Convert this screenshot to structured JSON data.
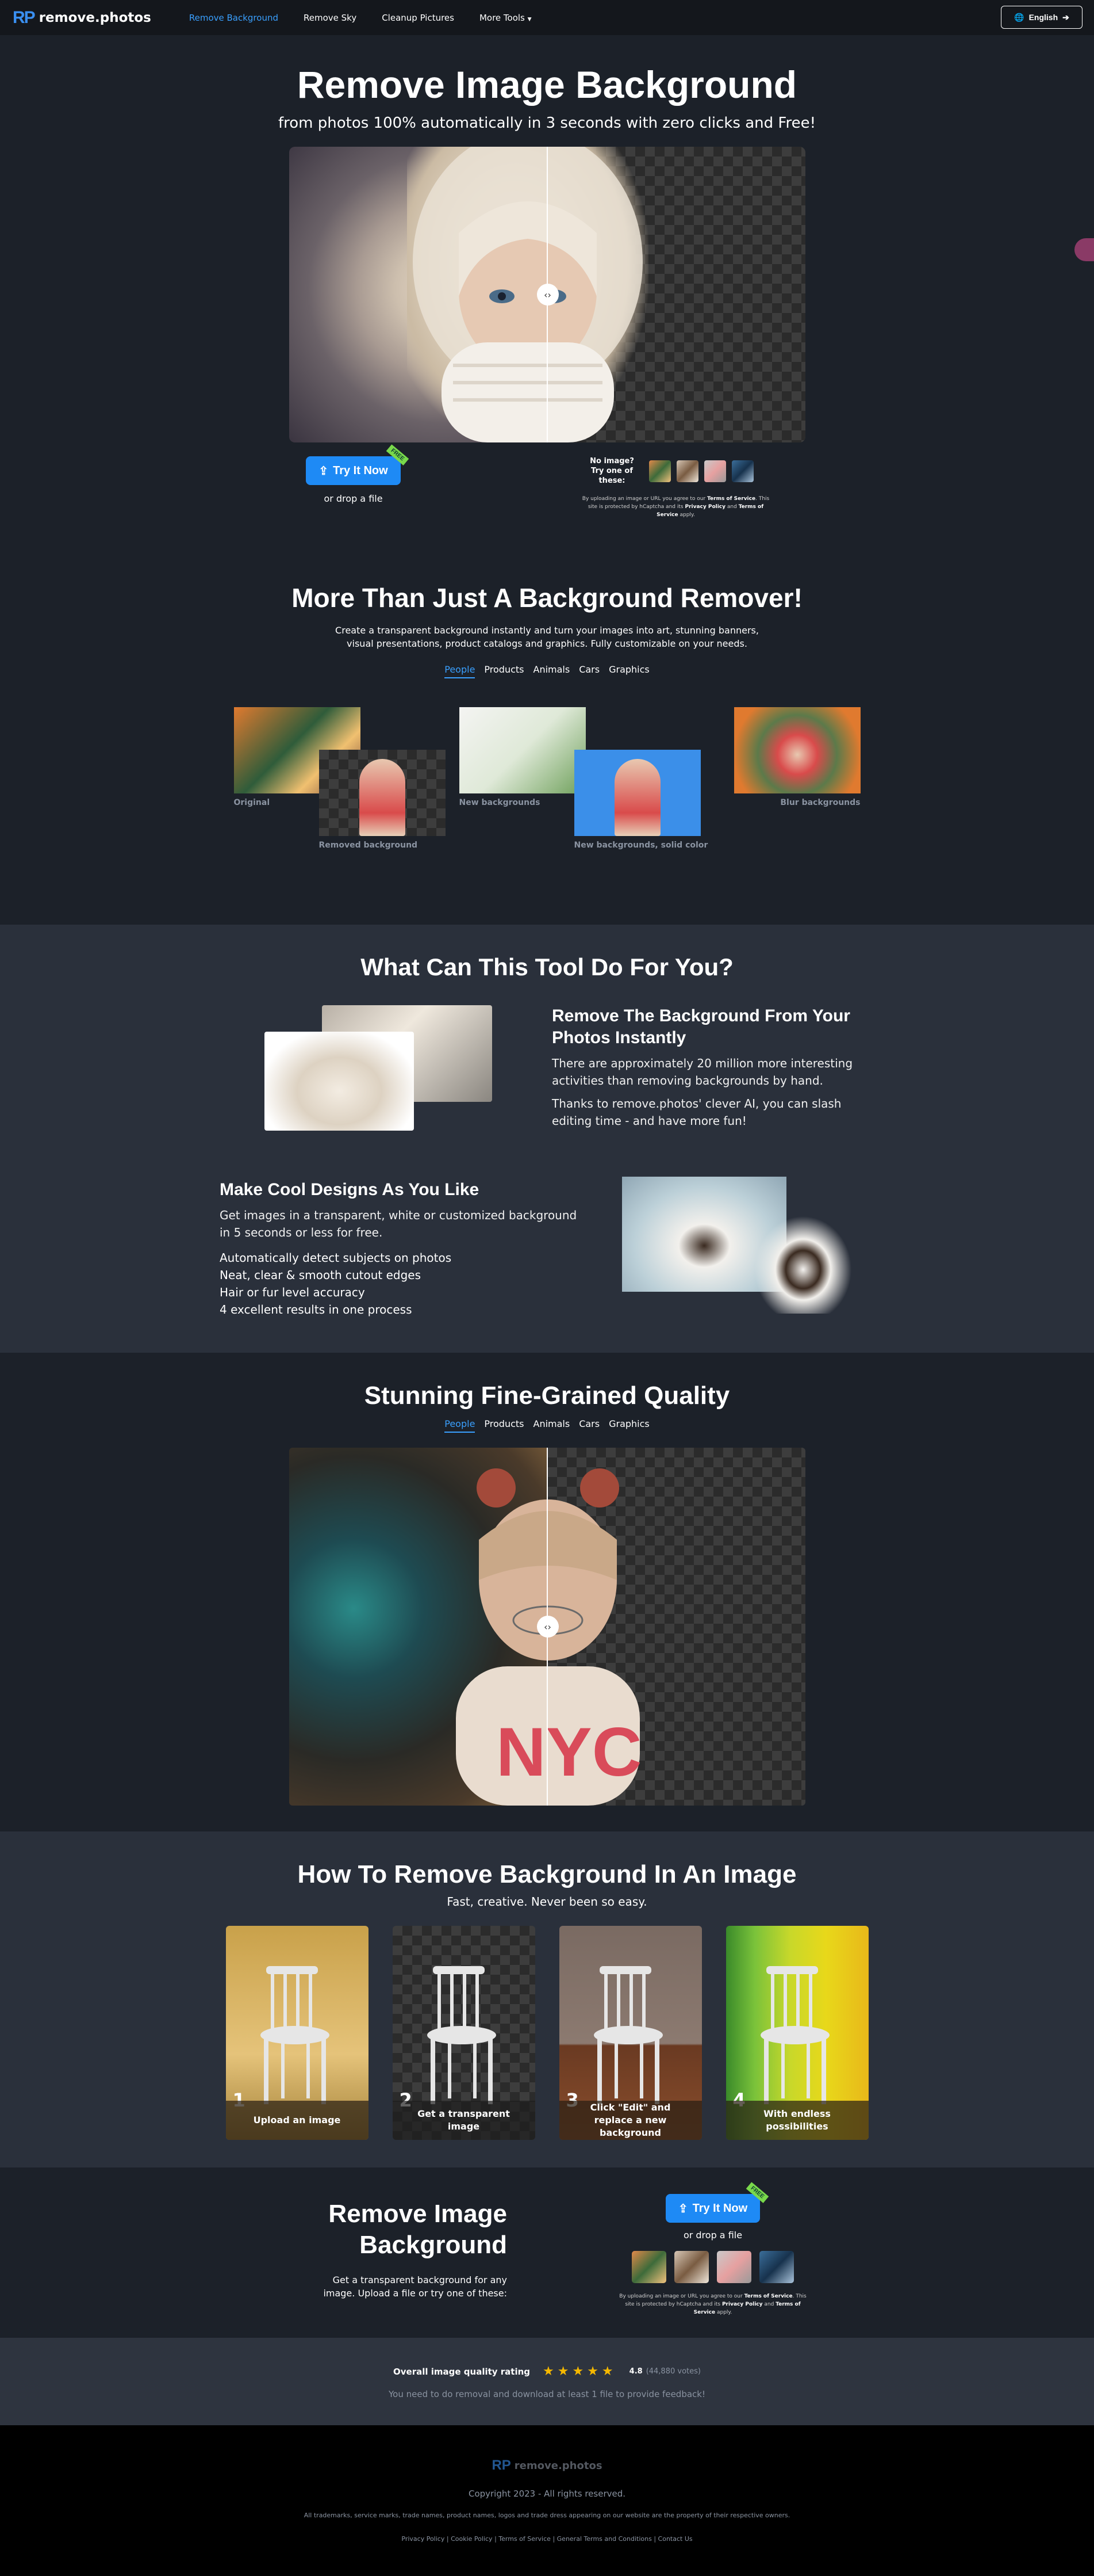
{
  "header": {
    "logo_mark": "RP",
    "logo_text": "remove.photos",
    "nav": [
      "Remove Background",
      "Remove Sky",
      "Cleanup Pictures",
      "More Tools"
    ],
    "language": "English"
  },
  "hero": {
    "title": "Remove Image Background",
    "subtitle": "from photos 100% automatically in 3 seconds with zero clicks and Free!",
    "try_label": "Try It Now",
    "free_badge": "FREE",
    "drop_label": "or drop a file",
    "no_image_label": "No image?",
    "try_samples_label": "Try one of these:",
    "legal_prefix": "By uploading an image or URL you agree to our",
    "terms": "Terms of Service",
    "legal_mid": ". This site is protected by hCaptcha and its",
    "privacy": "Privacy Policy",
    "legal_and": "and",
    "legal_end": "apply."
  },
  "section2": {
    "title": "More Than Just A Background Remover!",
    "description": "Create a transparent background instantly and turn your images into art, stunning banners, visual presentations, product catalogs and graphics. Fully customizable on your needs.",
    "tabs": [
      "People",
      "Products",
      "Animals",
      "Cars",
      "Graphics"
    ],
    "captions": {
      "original": "Original",
      "removed": "Removed background",
      "new_bg": "New backgrounds",
      "solid": "New backgrounds, solid color",
      "blur": "Blur backgrounds"
    }
  },
  "section3": {
    "title": "What Can This Tool Do For You?",
    "feature1_title": "Remove The Background From Your Photos Instantly",
    "feature1_p1": "There are approximately 20 million more interesting activities than removing backgrounds by hand.",
    "feature1_p2": "Thanks to remove.photos' clever AI, you can slash editing time - and have more fun!",
    "feature2_title": "Make Cool Designs As You Like",
    "feature2_p1": "Get images in a transparent, white or customized background in 5 seconds or less for free.",
    "feature2_list": [
      "Automatically detect subjects on photos",
      "Neat, clear & smooth cutout edges",
      "Hair or fur level accuracy",
      "4 excellent results in one process"
    ]
  },
  "section4": {
    "title": "Stunning Fine-Grained Quality",
    "tabs": [
      "People",
      "Products",
      "Animals",
      "Cars",
      "Graphics"
    ]
  },
  "section5": {
    "title": "How To Remove Background In An Image",
    "subtitle": "Fast, creative. Never been so easy.",
    "steps": [
      {
        "num": "1",
        "label": "Upload an image"
      },
      {
        "num": "2",
        "label": "Get a transparent image"
      },
      {
        "num": "3",
        "label": "Click \"Edit\" and replace a new background"
      },
      {
        "num": "4",
        "label": "With endless possibilities"
      }
    ]
  },
  "section6": {
    "title_line1": "Remove Image",
    "title_line2": "Background",
    "description": "Get a transparent background for any image. Upload a file or try one of these:",
    "try_label": "Try It Now",
    "free_badge": "FREE",
    "drop_label": "or drop a file"
  },
  "rating": {
    "label": "Overall image quality rating",
    "stars": "★★★★★",
    "score": "4.8",
    "votes": "(44,880 votes)",
    "note": "You need to do removal and download at least 1 file to provide feedback!"
  },
  "footer": {
    "logo_mark": "RP",
    "logo_text": "remove.photos",
    "copyright": "Copyright 2023 - All rights reserved.",
    "trademark": "All trademarks, service marks, trade names, product names, logos and trade dress appearing on our website are the property of their respective owners.",
    "links": [
      "Privacy Policy",
      "Cookie Policy",
      "Terms of Service",
      "General Terms and Conditions",
      "Contact Us"
    ],
    "separator": "|"
  },
  "colors": {
    "accent": "#1e8af5",
    "link_active": "#3aa0ff",
    "badge": "#79d94b",
    "star": "#f5b800"
  },
  "icons": [
    "upload-icon",
    "globe-icon",
    "arrow-right-icon",
    "chevron-down-icon",
    "compare-handle-icon"
  ]
}
